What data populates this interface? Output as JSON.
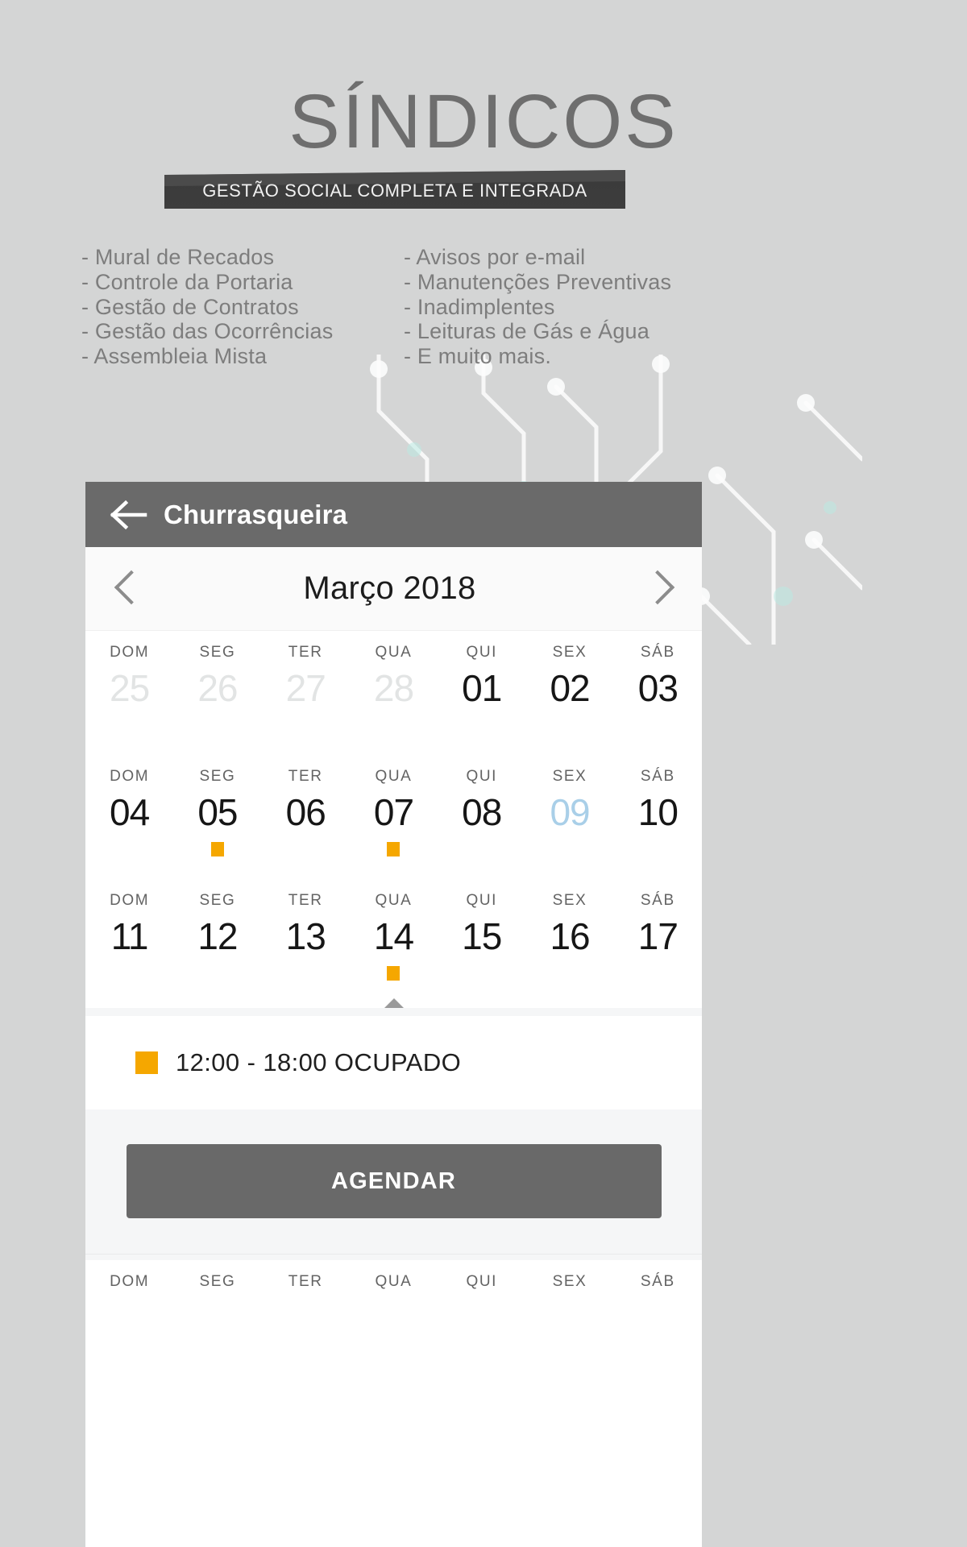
{
  "hero": {
    "title": "SÍNDICOS",
    "banner": "GESTÃO SOCIAL COMPLETA E INTEGRADA",
    "features_left": [
      "- Mural de Recados",
      "- Controle da Portaria",
      "- Gestão de Contratos",
      "- Gestão das Ocorrências",
      "- Assembleia Mista"
    ],
    "features_right": [
      "- Avisos por e-mail",
      "- Manutenções Preventivas",
      "- Inadimplentes",
      "- Leituras de Gás e Água",
      "- E muito mais."
    ]
  },
  "app": {
    "header": {
      "back_icon": "back-arrow-icon",
      "title": "Churrasqueira"
    },
    "calendar": {
      "prev_icon": "chevron-left-icon",
      "next_icon": "chevron-right-icon",
      "month_label": "Março 2018",
      "dow": [
        "DOM",
        "SEG",
        "TER",
        "QUA",
        "QUI",
        "SEX",
        "SÁB"
      ],
      "weeks": [
        {
          "days": [
            {
              "num": "25",
              "state": "muted",
              "marker": false
            },
            {
              "num": "26",
              "state": "muted",
              "marker": false
            },
            {
              "num": "27",
              "state": "muted",
              "marker": false
            },
            {
              "num": "28",
              "state": "muted",
              "marker": false
            },
            {
              "num": "01",
              "state": "normal",
              "marker": false
            },
            {
              "num": "02",
              "state": "normal",
              "marker": false
            },
            {
              "num": "03",
              "state": "normal",
              "marker": false
            }
          ]
        },
        {
          "days": [
            {
              "num": "04",
              "state": "normal",
              "marker": false
            },
            {
              "num": "05",
              "state": "normal",
              "marker": true
            },
            {
              "num": "06",
              "state": "normal",
              "marker": false
            },
            {
              "num": "07",
              "state": "normal",
              "marker": true
            },
            {
              "num": "08",
              "state": "normal",
              "marker": false
            },
            {
              "num": "09",
              "state": "today",
              "marker": false
            },
            {
              "num": "10",
              "state": "normal",
              "marker": false
            }
          ]
        },
        {
          "days": [
            {
              "num": "11",
              "state": "normal",
              "marker": false
            },
            {
              "num": "12",
              "state": "normal",
              "marker": false
            },
            {
              "num": "13",
              "state": "normal",
              "marker": false
            },
            {
              "num": "14",
              "state": "normal",
              "marker": true
            },
            {
              "num": "15",
              "state": "normal",
              "marker": false
            },
            {
              "num": "16",
              "state": "normal",
              "marker": false
            },
            {
              "num": "17",
              "state": "normal",
              "marker": false
            }
          ]
        }
      ],
      "collapse_icon": "collapse-up-triangle-icon",
      "tail_dow": [
        "DOM",
        "SEG",
        "TER",
        "QUA",
        "QUI",
        "SEX",
        "SÁB"
      ]
    },
    "legend": {
      "swatch_color": "#F5A700",
      "text": "12:00 - 18:00 OCUPADO"
    },
    "action": {
      "label": "AGENDAR"
    }
  },
  "colors": {
    "hero_text": "#6E6E6E",
    "banner_bg": "#3D3D3D",
    "header_bg": "#6A6A6A",
    "accent_orange": "#F5A700",
    "today_blue": "#A9CFE8",
    "button_bg": "#696969",
    "page_bg": "#D4D5D5"
  }
}
